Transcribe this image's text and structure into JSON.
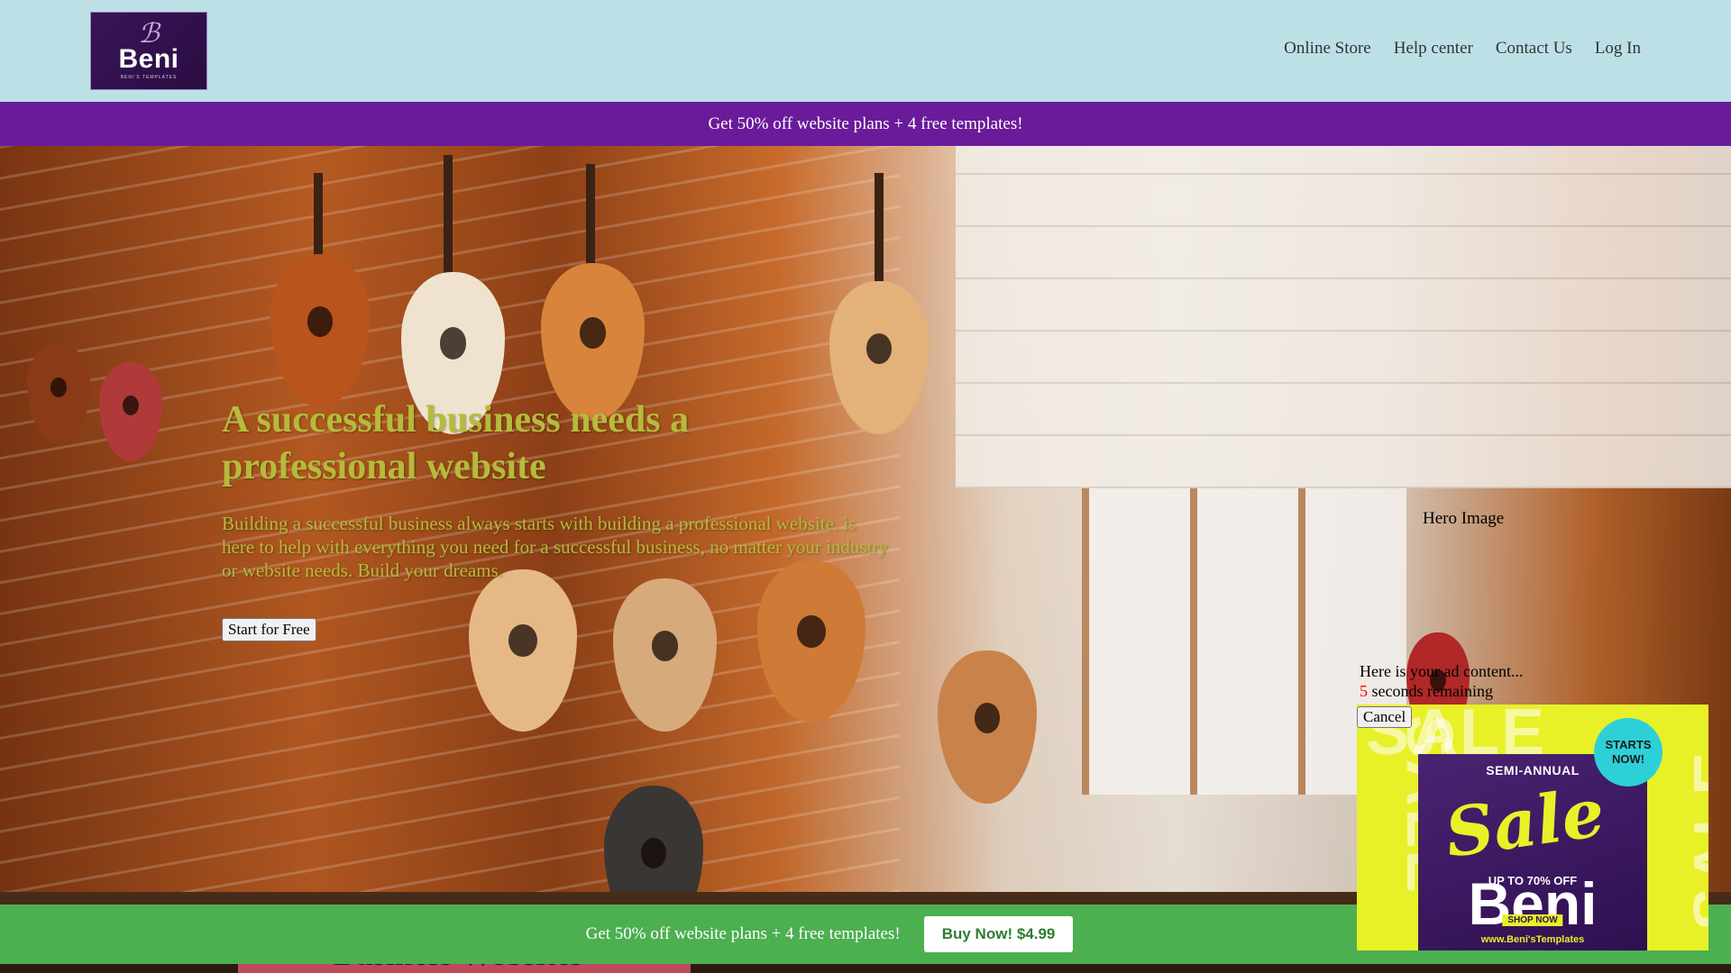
{
  "header": {
    "logo": {
      "text": "Beni",
      "subtitle": "BENI'S TEMPLATES"
    },
    "nav": [
      {
        "label": "Online Store"
      },
      {
        "label": "Help center"
      },
      {
        "label": "Contact Us"
      },
      {
        "label": "Log In"
      }
    ]
  },
  "promo_bar": {
    "text": "Get 50% off website plans + 4 free templates!"
  },
  "hero": {
    "title": "A successful business needs a professional website",
    "body": "Building a successful business always starts with building a professional website. is here to help with everything you need for a successful business, no matter your industry or website needs. Build your dreams.",
    "cta_label": "Start for Free",
    "image_alt": "Hero Image"
  },
  "ad": {
    "message": "Here is your ad content...",
    "countdown": "5",
    "countdown_suffix": " seconds remaining",
    "cancel_label": "Cancel",
    "banner": {
      "semi": "SEMI-ANNUAL",
      "sale": "Sale",
      "off": "UP TO 70% OFF",
      "brand": "Beni",
      "shop": "SHOP NOW",
      "url": "www.Beni'sTemplates",
      "badge_line1": "STARTS",
      "badge_line2": "NOW!",
      "watermark": "SALE"
    }
  },
  "section": {
    "title": "Business Websites"
  },
  "bottom_bar": {
    "text": "Get 50% off website plans + 4 free templates!",
    "button_label": "Buy Now! $4.99"
  },
  "colors": {
    "header_bg": "#bde0e6",
    "promo_bg": "#6a1b9a",
    "hero_text": "#b5bb3a",
    "bottom_bar_bg": "#4caf50",
    "ad_bg": "#e8f028",
    "ad_card": "#4a2372"
  }
}
